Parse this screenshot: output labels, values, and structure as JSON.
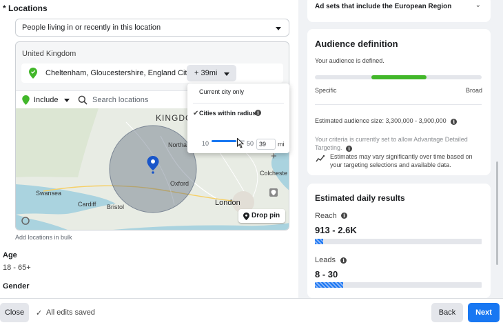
{
  "locations": {
    "section_title": "* Locations",
    "targeting_type": "People living in or recently in this location",
    "country": "United Kingdom",
    "selected_location": "Cheltenham, Gloucestershire, England City",
    "radius_button": "+ 39mi",
    "include_label": "Include",
    "search_placeholder": "Search locations",
    "add_bulk": "Add locations in bulk",
    "drop_pin": "Drop pin",
    "map_labels": {
      "kingdom": "KINGDO",
      "northampton": "Northa",
      "colchester": "Colcheste",
      "oxford": "Oxford",
      "swansea": "Swansea",
      "cardiff": "Cardiff",
      "bristol": "Bristol",
      "london": "London"
    }
  },
  "radius_popover": {
    "option_city_only": "Current city only",
    "option_radius": "Cities within radius",
    "check": "✔",
    "min": "10",
    "max": "50",
    "value": "39",
    "unit": "mi"
  },
  "demographics": {
    "age_label": "Age",
    "age_value": "18 - 65+",
    "gender_label": "Gender"
  },
  "right": {
    "european_region": "Ad sets that include the European Region",
    "audience_definition": {
      "title": "Audience definition",
      "status": "Your audience is defined.",
      "specific": "Specific",
      "broad": "Broad",
      "estimated_size": "Estimated audience size: 3,300,000 - 3,900,000",
      "criteria": "Your criteria is currently set to allow Advantage Detailed Targeting.",
      "warning": "Estimates may vary significantly over time based on your targeting selections and available data."
    },
    "daily_results": {
      "title": "Estimated daily results",
      "reach_label": "Reach",
      "reach_value": "913 - 2.6K",
      "reach_fraction": 0.05,
      "leads_label": "Leads",
      "leads_value": "8 - 30",
      "leads_fraction": 0.17
    }
  },
  "footer": {
    "close": "Close",
    "saved": "All edits saved",
    "back": "Back",
    "next": "Next"
  },
  "colors": {
    "accent": "#1877f2",
    "meter": "#42b72a",
    "pin": "#42b72a"
  }
}
